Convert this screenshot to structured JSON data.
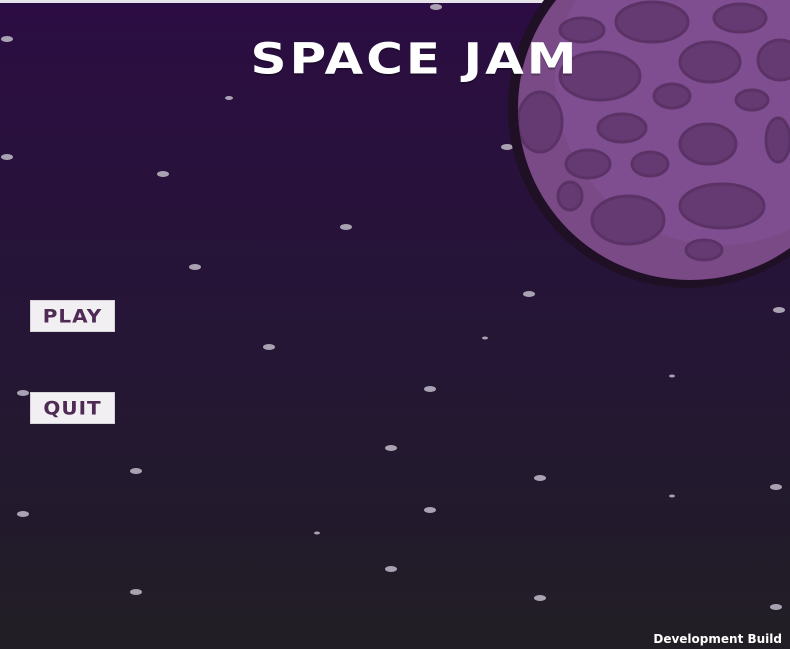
{
  "game": {
    "title": "SPACE JAM"
  },
  "menu": {
    "play_label": "PLAY",
    "quit_label": "QUIT"
  },
  "build": {
    "label": "Development Build"
  },
  "colors": {
    "sky_top": "#2c0c44",
    "sky_bottom": "#211f25",
    "planet_fill": "#7a4a86",
    "planet_crater": "#653a72",
    "button_background": "#f1eff2",
    "button_text": "#4e2a55",
    "title_text": "#ffffff"
  }
}
